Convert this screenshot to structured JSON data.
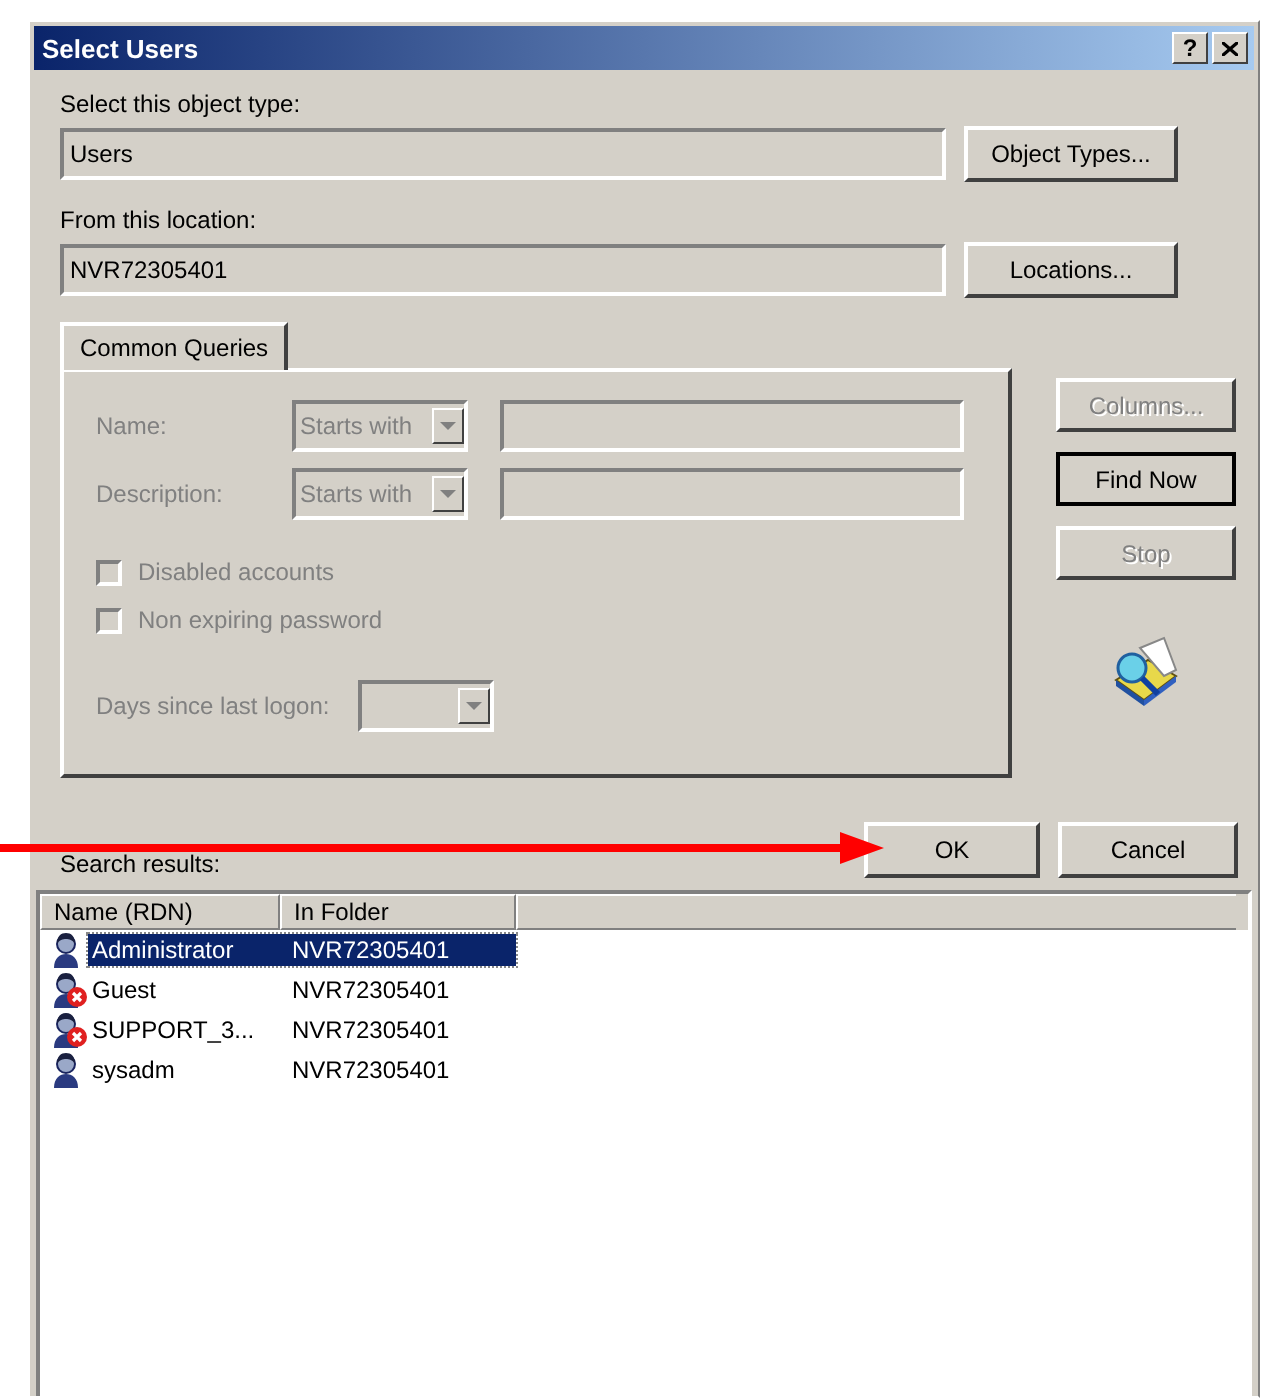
{
  "window": {
    "title": "Select Users",
    "help_button": "?"
  },
  "object_type": {
    "label": "Select this object type:",
    "value": "Users",
    "button": "Object Types..."
  },
  "location": {
    "label": "From this location:",
    "value": "NVR72305401",
    "button": "Locations..."
  },
  "tabs": [
    {
      "label": "Common Queries",
      "selected": true
    }
  ],
  "query_fields": [
    {
      "label": "Name:",
      "operator": "Starts with",
      "disabled": true
    },
    {
      "label": "Description:",
      "operator": "Starts with",
      "disabled": true
    }
  ],
  "checkboxes": [
    {
      "label": "Disabled accounts",
      "checked": false,
      "disabled": true
    },
    {
      "label": "Non expiring password",
      "checked": false,
      "disabled": true
    }
  ],
  "days_since_logon": {
    "label": "Days since last logon:",
    "disabled": true
  },
  "side_buttons": [
    {
      "label": "Columns...",
      "disabled": true,
      "default": false
    },
    {
      "label": "Find Now",
      "disabled": false,
      "default": true
    },
    {
      "label": "Stop",
      "disabled": true,
      "default": false
    }
  ],
  "dialog_buttons": [
    "OK",
    "Cancel"
  ],
  "results": {
    "label": "Search results:",
    "columns": [
      "Name (RDN)",
      "In Folder"
    ],
    "rows": [
      {
        "name": "Administrator",
        "folder": "NVR72305401",
        "selected": true,
        "account_disabled": false
      },
      {
        "name": "Guest",
        "folder": "NVR72305401",
        "selected": false,
        "account_disabled": true
      },
      {
        "name": "SUPPORT_3...",
        "folder": "NVR72305401",
        "selected": false,
        "account_disabled": true
      },
      {
        "name": "sysadm",
        "folder": "NVR72305401",
        "selected": false,
        "account_disabled": false
      }
    ]
  }
}
